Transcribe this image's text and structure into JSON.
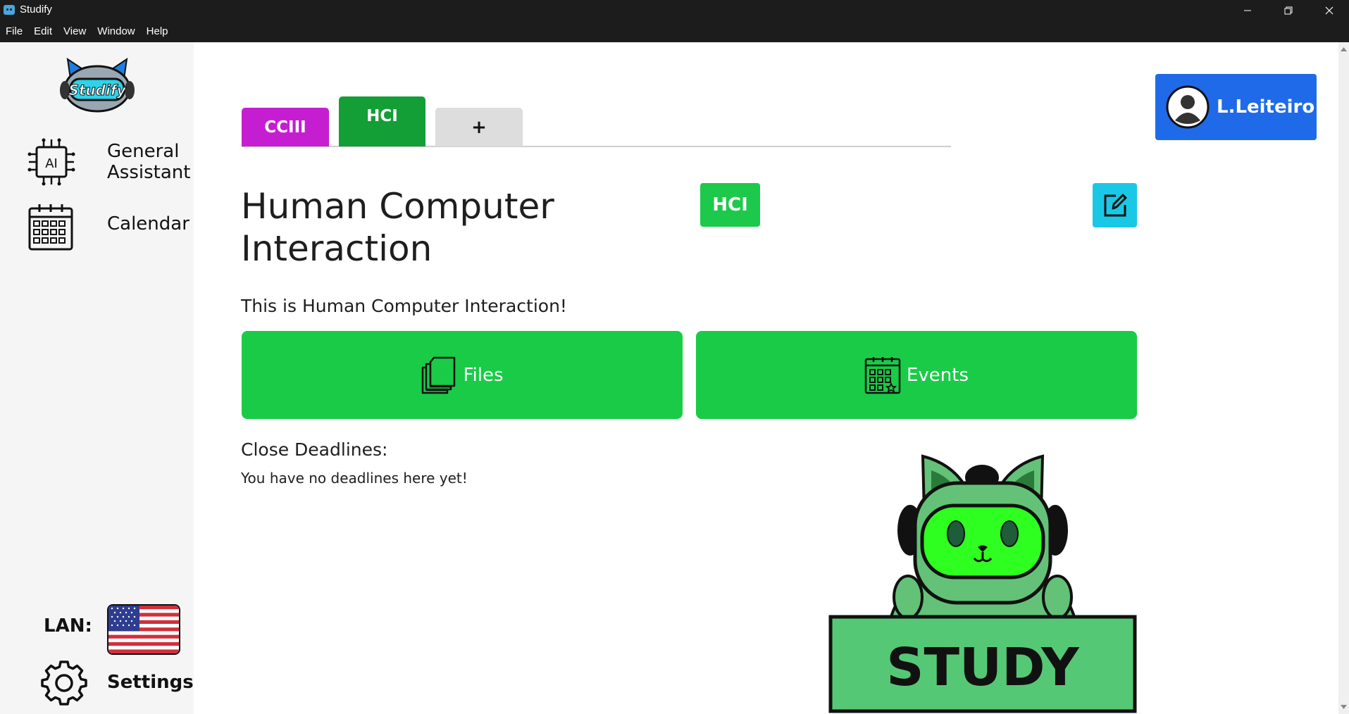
{
  "window": {
    "title": "Studify",
    "menu": [
      "File",
      "Edit",
      "View",
      "Window",
      "Help"
    ]
  },
  "sidebar": {
    "logo_text": "Studify",
    "items": [
      {
        "label": "General Assistant",
        "icon": "ai-chip-icon"
      },
      {
        "label": "Calendar",
        "icon": "calendar-icon"
      }
    ],
    "lan_label": "LAN:",
    "language_flag": "us-flag-icon",
    "settings_label": "Settings"
  },
  "tabs": [
    {
      "label": "CCIII",
      "color": "#c51ed0",
      "active": false
    },
    {
      "label": "HCI",
      "color": "#149e36",
      "active": true
    },
    {
      "label": "+",
      "color": "#dddddd",
      "active": false
    }
  ],
  "course": {
    "title": "Human Computer Interaction",
    "code": "HCI",
    "description": "This is Human Computer Interaction!",
    "files_label": "Files",
    "events_label": "Events",
    "deadlines_title": "Close Deadlines:",
    "deadlines_empty": "You have no deadlines here yet!"
  },
  "user": {
    "name": "L.Leiteiro"
  },
  "mascot_sign": "STUDY",
  "colors": {
    "accent_green": "#1acb47",
    "user_blue": "#1f6ae8",
    "edit_cyan": "#1ac8e6"
  }
}
